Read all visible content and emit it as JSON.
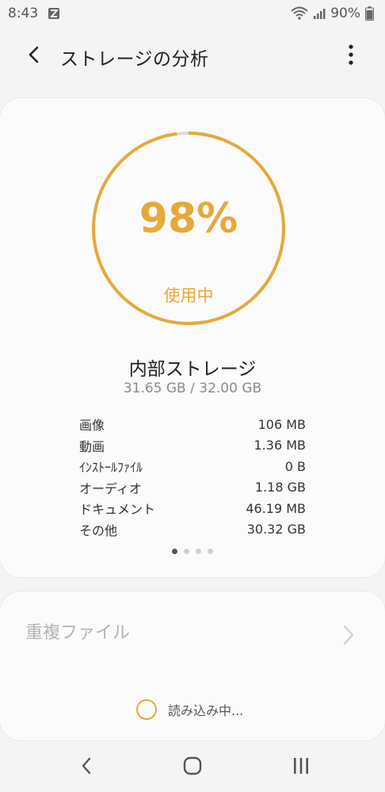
{
  "status_bar": {
    "time": "8:43",
    "notification_icon": "app-notification-icon",
    "wifi_icon": "wifi-icon",
    "signal_icon": "cell-signal-icon",
    "battery_percent": "90%",
    "battery_icon": "battery-icon",
    "battery_level": 0.9
  },
  "app_bar": {
    "back_icon": "chevron-left-icon",
    "title": "ストレージの分析",
    "more_icon": "more-vertical-icon"
  },
  "storage": {
    "usage_percent": "98%",
    "usage_fraction": 0.98,
    "usage_label": "使用中",
    "name": "内部ストレージ",
    "size": "31.65 GB / 32.00 GB",
    "accent_color": "#e6a93a",
    "track_color": "#dcdcdc",
    "breakdown": [
      {
        "label": "画像",
        "value": "106 MB"
      },
      {
        "label": "動画",
        "value": "1.36 MB"
      },
      {
        "label": "ｲﾝｽﾄｰﾙﾌｧｲﾙ",
        "value": "0 B"
      },
      {
        "label": "オーディオ",
        "value": "1.18 GB"
      },
      {
        "label": "ドキュメント",
        "value": "46.19 MB"
      },
      {
        "label": "その他",
        "value": "30.32 GB"
      }
    ],
    "page_count": 4,
    "active_page": 1
  },
  "duplicates": {
    "title": "重複ファイル",
    "chevron_icon": "chevron-right-icon",
    "loading_text": "読み込み中..."
  },
  "nav_bar": {
    "back_icon": "nav-back-icon",
    "home_icon": "nav-home-icon",
    "recents_icon": "nav-recents-icon"
  }
}
